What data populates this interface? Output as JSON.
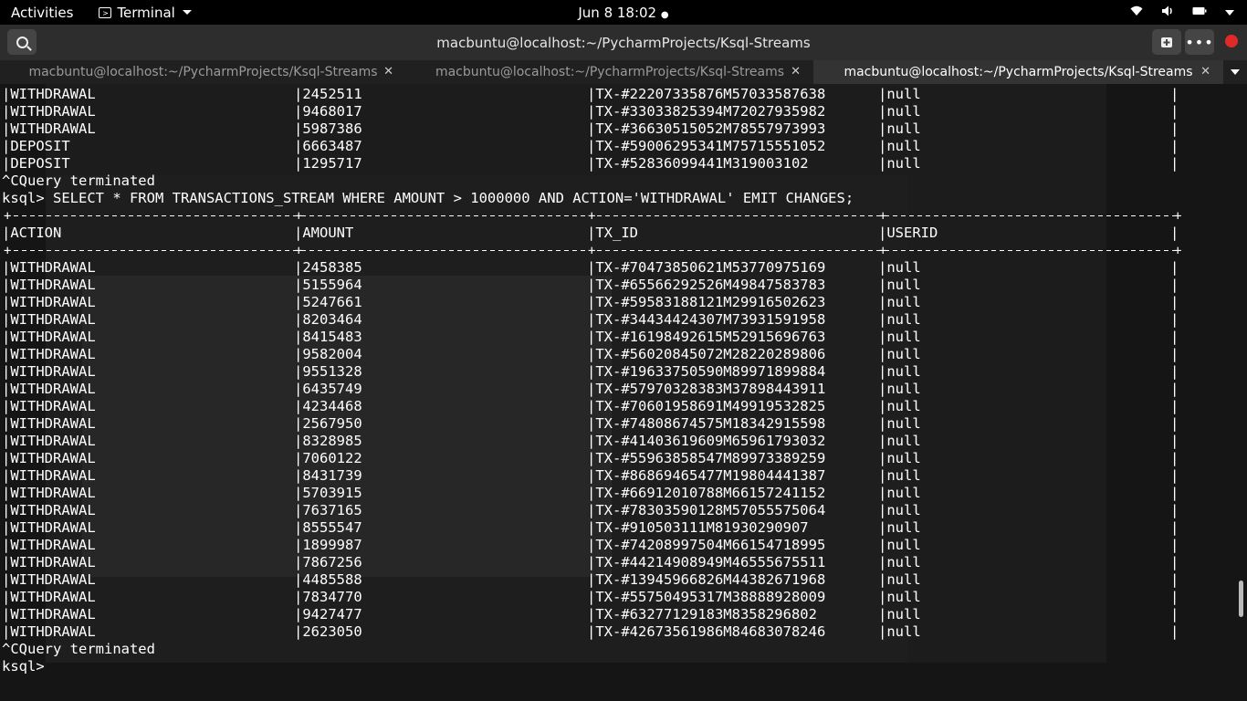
{
  "topbar": {
    "activities": "Activities",
    "app_name": "Terminal",
    "clock": "Jun 8  18:02",
    "icons": [
      "wifi-icon",
      "volume-icon",
      "battery-icon",
      "power-icon"
    ]
  },
  "window": {
    "title": "macbuntu@localhost:~/PycharmProjects/Ksql-Streams"
  },
  "tabs": [
    {
      "label": "macbuntu@localhost:~/PycharmProjects/Ksql-Streams",
      "active": false
    },
    {
      "label": "macbuntu@localhost:~/PycharmProjects/Ksql-Streams",
      "active": false
    },
    {
      "label": "macbuntu@localhost:~/PycharmProjects/Ksql-Streams",
      "active": true
    }
  ],
  "terminal": {
    "prev_rows": [
      [
        "WITHDRAWAL",
        "2452511",
        "TX-#22207335876M57033587638",
        "null"
      ],
      [
        "WITHDRAWAL",
        "9468017",
        "TX-#33033825394M72027935982",
        "null"
      ],
      [
        "WITHDRAWAL",
        "5987386",
        "TX-#36630515052M78557973993",
        "null"
      ],
      [
        "DEPOSIT",
        "6663487",
        "TX-#59006295341M75715551052",
        "null"
      ],
      [
        "DEPOSIT",
        "1295717",
        "TX-#52836099441M319003102",
        "null"
      ]
    ],
    "terminated_1": "^CQuery terminated",
    "command": "ksql> SELECT * FROM TRANSACTIONS_STREAM WHERE AMOUNT > 1000000 AND ACTION='WITHDRAWAL' EMIT CHANGES;",
    "headers": [
      "ACTION",
      "AMOUNT",
      "TX_ID",
      "USERID"
    ],
    "rows": [
      [
        "WITHDRAWAL",
        "2458385",
        "TX-#70473850621M53770975169",
        "null"
      ],
      [
        "WITHDRAWAL",
        "5155964",
        "TX-#65566292526M49847583783",
        "null"
      ],
      [
        "WITHDRAWAL",
        "5247661",
        "TX-#59583188121M29916502623",
        "null"
      ],
      [
        "WITHDRAWAL",
        "8203464",
        "TX-#34434424307M73931591958",
        "null"
      ],
      [
        "WITHDRAWAL",
        "8415483",
        "TX-#16198492615M52915696763",
        "null"
      ],
      [
        "WITHDRAWAL",
        "9582004",
        "TX-#56020845072M28220289806",
        "null"
      ],
      [
        "WITHDRAWAL",
        "9551328",
        "TX-#19633750590M89971899884",
        "null"
      ],
      [
        "WITHDRAWAL",
        "6435749",
        "TX-#57970328383M37898443911",
        "null"
      ],
      [
        "WITHDRAWAL",
        "4234468",
        "TX-#70601958691M49919532825",
        "null"
      ],
      [
        "WITHDRAWAL",
        "2567950",
        "TX-#74808674575M18342915598",
        "null"
      ],
      [
        "WITHDRAWAL",
        "8328985",
        "TX-#41403619609M65961793032",
        "null"
      ],
      [
        "WITHDRAWAL",
        "7060122",
        "TX-#55963858547M89973389259",
        "null"
      ],
      [
        "WITHDRAWAL",
        "8431739",
        "TX-#86869465477M19804441387",
        "null"
      ],
      [
        "WITHDRAWAL",
        "5703915",
        "TX-#66912010788M66157241152",
        "null"
      ],
      [
        "WITHDRAWAL",
        "7637165",
        "TX-#78303590128M57055575064",
        "null"
      ],
      [
        "WITHDRAWAL",
        "8555547",
        "TX-#910503111M81930290907",
        "null"
      ],
      [
        "WITHDRAWAL",
        "1899987",
        "TX-#74208997504M66154718995",
        "null"
      ],
      [
        "WITHDRAWAL",
        "7867256",
        "TX-#44214908949M46555675511",
        "null"
      ],
      [
        "WITHDRAWAL",
        "4485588",
        "TX-#13945966826M44382671968",
        "null"
      ],
      [
        "WITHDRAWAL",
        "7834770",
        "TX-#55750495317M38888928009",
        "null"
      ],
      [
        "WITHDRAWAL",
        "9427477",
        "TX-#63277129183M8358296802",
        "null"
      ],
      [
        "WITHDRAWAL",
        "2623050",
        "TX-#42673561986M84683078246",
        "null"
      ]
    ],
    "terminated_2": "^CQuery terminated",
    "prompt": "ksql> "
  }
}
